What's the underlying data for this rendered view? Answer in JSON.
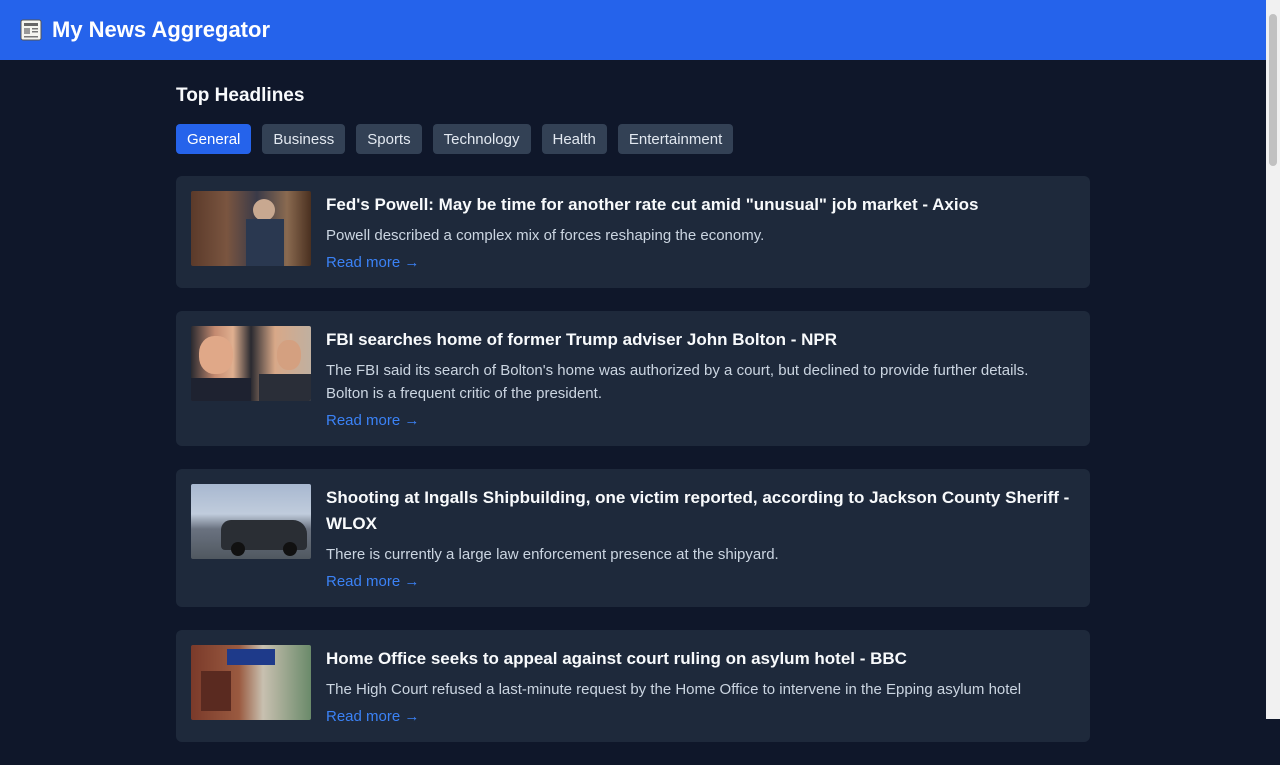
{
  "app": {
    "title": "My News Aggregator",
    "icon": "newspaper-icon"
  },
  "section": {
    "title": "Top Headlines"
  },
  "tabs": [
    {
      "label": "General",
      "active": true
    },
    {
      "label": "Business",
      "active": false
    },
    {
      "label": "Sports",
      "active": false
    },
    {
      "label": "Technology",
      "active": false
    },
    {
      "label": "Health",
      "active": false
    },
    {
      "label": "Entertainment",
      "active": false
    }
  ],
  "articles": [
    {
      "headline": "Fed's Powell: May be time for another rate cut amid \"unusual\" job market - Axios",
      "description": "Powell described a complex mix of forces reshaping the economy.",
      "read_more": "Read more →"
    },
    {
      "headline": "FBI searches home of former Trump adviser John Bolton - NPR",
      "description": "The FBI said its search of Bolton's home was authorized by a court, but declined to provide further details. Bolton is a frequent critic of the president.",
      "read_more": "Read more →"
    },
    {
      "headline": "Shooting at Ingalls Shipbuilding, one victim reported, according to Jackson County Sheriff - WLOX",
      "description": "There is currently a large law enforcement presence at the shipyard.",
      "read_more": "Read more →"
    },
    {
      "headline": "Home Office seeks to appeal against court ruling on asylum hotel - BBC",
      "description": "The High Court refused a last-minute request by the Home Office to intervene in the Epping asylum hotel",
      "read_more": "Read more →"
    }
  ],
  "colors": {
    "header": "#2563eb",
    "background": "#0f172a",
    "card": "#1e293b",
    "tab": "#334155",
    "tab_active": "#2563eb",
    "link": "#3b82f6"
  }
}
